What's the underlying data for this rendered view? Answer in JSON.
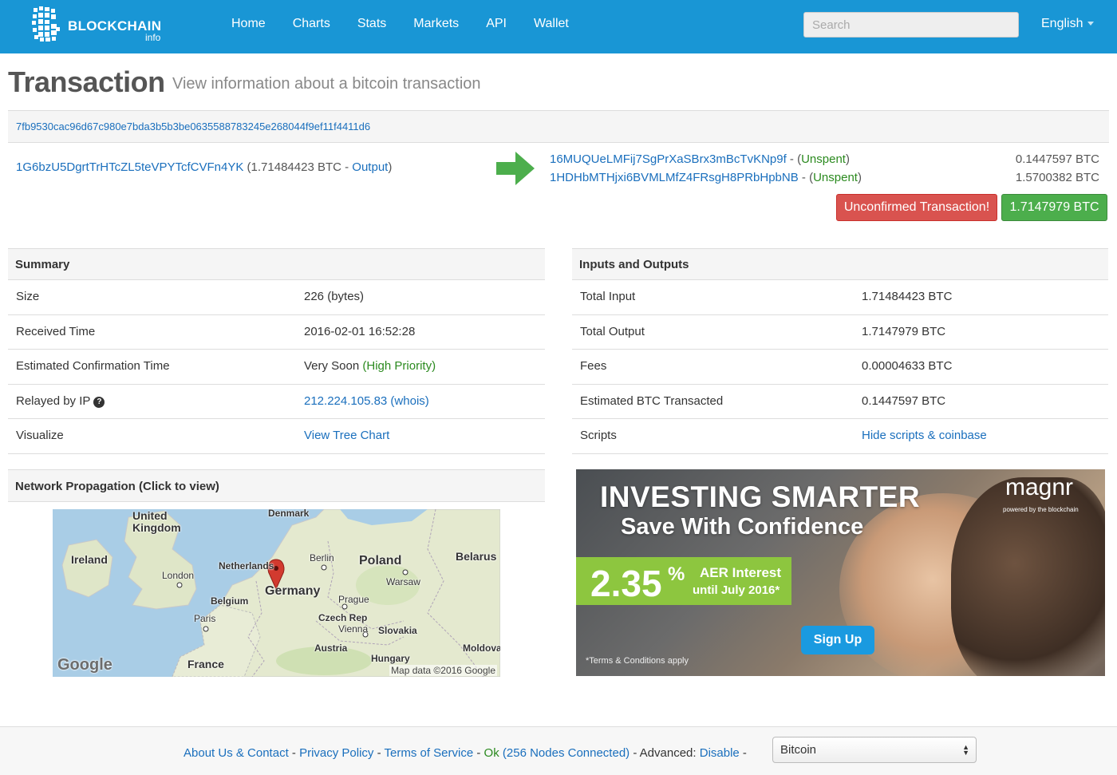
{
  "navbar": {
    "brand": "BLOCKCHAIN",
    "brand_sub": "info",
    "links": [
      "Home",
      "Charts",
      "Stats",
      "Markets",
      "API",
      "Wallet"
    ],
    "search_placeholder": "Search",
    "language": "English"
  },
  "page": {
    "title": "Transaction",
    "subtitle": "View information about a bitcoin transaction"
  },
  "tx": {
    "hash": "7fb9530cac96d67c980e7bda3b5b3be0635588783245e268044f9ef11f4411d6",
    "input_address": "1G6bzU5DgrtTrHTcZL5teVPYTcfCVFn4YK",
    "input_amount": "(1.71484423 BTC - ",
    "input_link": "Output",
    "input_close": ")",
    "outputs": [
      {
        "address": "16MUQUeLMFij7SgPrXaSBrx3mBcTvKNp9f",
        "sep": " - (",
        "status": "Unspent",
        "close": ")",
        "amount": "0.1447597 BTC"
      },
      {
        "address": "1HDHbMTHjxi6BVMLMfZ4FRsgH8PRbHpbNB",
        "sep": " - (",
        "status": "Unspent",
        "close": ")",
        "amount": "1.5700382 BTC"
      }
    ],
    "unconfirmed_label": "Unconfirmed Transaction!",
    "total_label": "1.7147979 BTC"
  },
  "summary": {
    "heading": "Summary",
    "size_label": "Size",
    "size_value": "226 (bytes)",
    "received_label": "Received Time",
    "received_value": "2016-02-01 16:52:28",
    "confirm_label": "Estimated Confirmation Time",
    "confirm_value": "Very Soon ",
    "confirm_priority": "(High Priority)",
    "relayed_label": "Relayed by IP",
    "relayed_help": "?",
    "relayed_value": "212.224.105.83 (whois)",
    "visualize_label": "Visualize",
    "visualize_value": "View Tree Chart"
  },
  "io": {
    "heading": "Inputs and Outputs",
    "total_input_label": "Total Input",
    "total_input_value": "1.71484423 BTC",
    "total_output_label": "Total Output",
    "total_output_value": "1.7147979 BTC",
    "fees_label": "Fees",
    "fees_value": "0.00004633 BTC",
    "est_label": "Estimated BTC Transacted",
    "est_value": "0.1447597 BTC",
    "scripts_label": "Scripts",
    "scripts_value": "Hide scripts & coinbase"
  },
  "map": {
    "heading": "Network Propagation (Click to view)",
    "labels": {
      "uk": "United\nKingdom",
      "ireland": "Ireland",
      "london": "London",
      "denmark": "Denmark",
      "netherlands": "Netherlands",
      "berlin": "Berlin",
      "poland": "Poland",
      "belarus": "Belarus",
      "warsaw": "Warsaw",
      "germany": "Germany",
      "belgium": "Belgium",
      "prague": "Prague",
      "paris": "Paris",
      "czech": "Czech Rep",
      "vienna": "Vienna",
      "slovakia": "Slovakia",
      "austria": "Austria",
      "hungary": "Hungary",
      "moldova": "Moldova",
      "france": "France"
    },
    "google_logo": "Google",
    "credit": "Map data ©2016 Google"
  },
  "ad": {
    "title": "INVESTING SMARTER",
    "subtitle": "Save With Confidence",
    "brand": "magnr",
    "brand_tag": "powered by the blockchain",
    "rate": "2.35",
    "pct": "%",
    "aer": "AER Interest",
    "until": "until July 2016*",
    "cta": "Sign Up",
    "terms": "*Terms & Conditions apply"
  },
  "footer": {
    "about": "About Us & Contact",
    "sep": " - ",
    "privacy": "Privacy Policy",
    "terms": "Terms of Service",
    "ok": "Ok",
    "nodes": "(256 Nodes Connected)",
    "advanced": "Advanced: ",
    "disable": "Disable",
    "currency": "Bitcoin"
  },
  "colors": {
    "navbar": "#1996d5",
    "link": "#1a6fbd",
    "green_text": "#2b8a1f",
    "danger": "#d9534f",
    "success": "#4cae4c",
    "ad_green": "#8dc63f"
  }
}
